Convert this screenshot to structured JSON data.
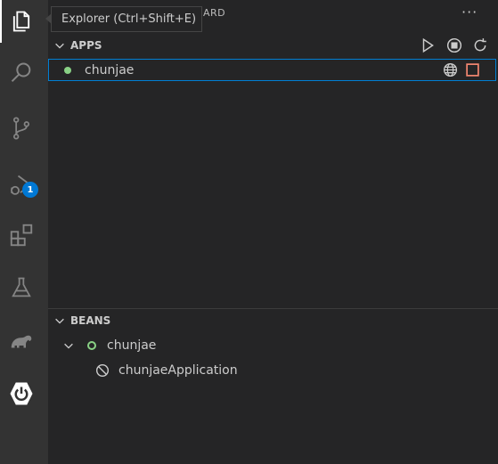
{
  "tooltip": {
    "text": "Explorer (Ctrl+Shift+E)"
  },
  "sidebar": {
    "title_partial": "ARD",
    "more_label": "···"
  },
  "activity_bar": {
    "items": [
      {
        "name": "explorer-icon",
        "active": true
      },
      {
        "name": "search-icon"
      },
      {
        "name": "source-control-icon"
      },
      {
        "name": "run-debug-icon",
        "badge": "1"
      },
      {
        "name": "extensions-icon"
      },
      {
        "name": "testing-icon"
      },
      {
        "name": "gradle-elephant-icon"
      },
      {
        "name": "spring-boot-power-icon"
      }
    ]
  },
  "apps": {
    "header": "APPS",
    "actions": [
      "run-icon",
      "stop-icon",
      "refresh-icon"
    ],
    "items": [
      {
        "label": "chunjae",
        "status_color": "#89d185",
        "actions": [
          "globe-icon",
          "stop-square-icon"
        ]
      }
    ]
  },
  "beans": {
    "header": "BEANS",
    "root": {
      "label": "chunjae",
      "status_color": "#89d185"
    },
    "children": [
      {
        "label": "chunjaeApplication",
        "icon": "bean-disabled-icon"
      }
    ]
  },
  "colors": {
    "accent": "#007fd4",
    "badge": "#0078d4",
    "running": "#89d185",
    "stop": "#f48771"
  }
}
